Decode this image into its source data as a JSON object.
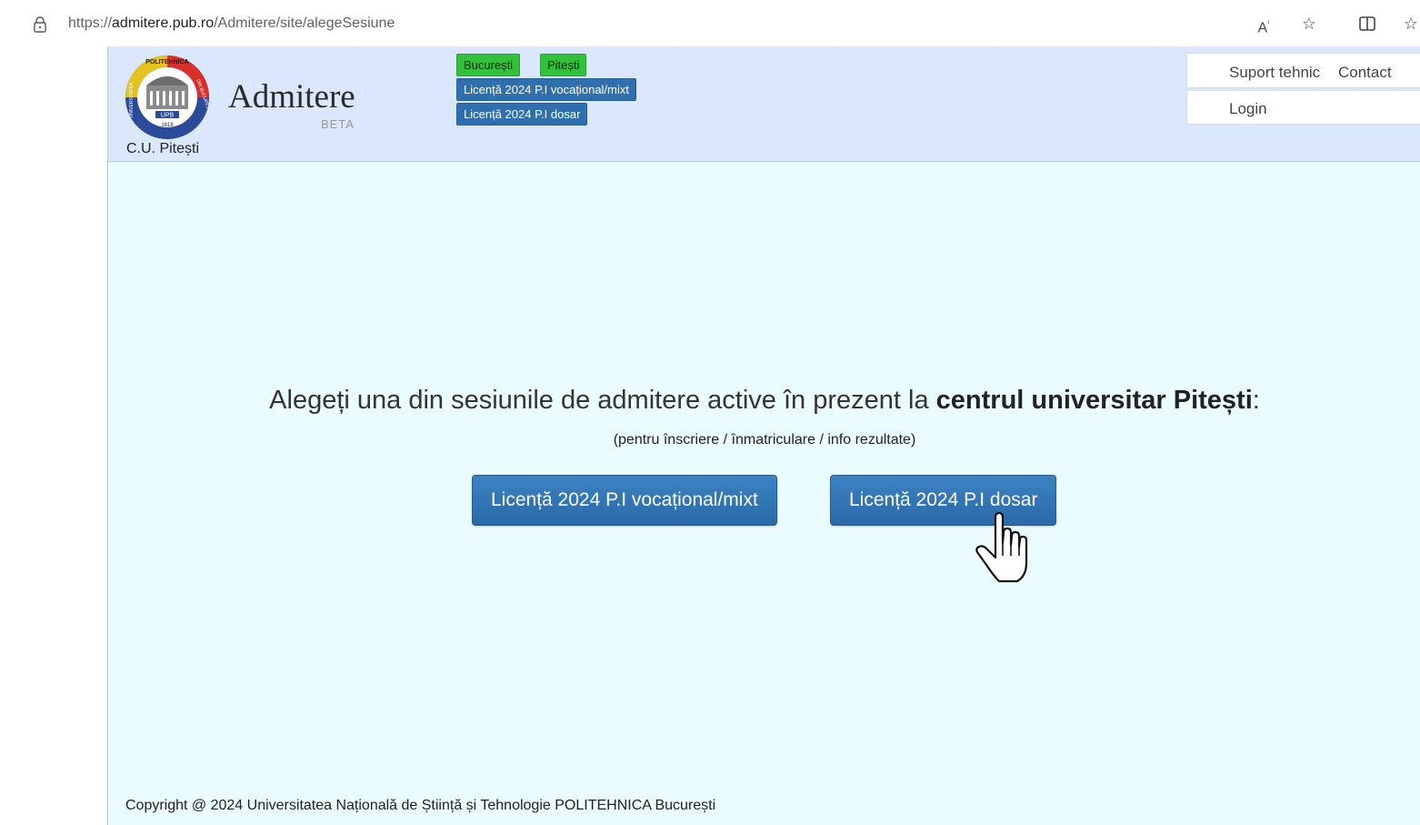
{
  "browser": {
    "url_prefix": "https://",
    "url_host": "admitere.pub.ro",
    "url_path": "/Admitere/site/alegeSesiune",
    "icons": [
      "lock-icon",
      "read-aloud-icon",
      "favorite-star-icon",
      "split-screen-icon",
      "favorites-icon"
    ]
  },
  "header": {
    "brand": "Admitere",
    "beta": "BETA",
    "center_label": "C.U. Pitești",
    "city_tags": [
      "București",
      "Pitești"
    ],
    "session_tags": [
      "Licență 2024 P.I vocațional/mixt",
      "Licență 2024 P.I dosar"
    ],
    "nav": {
      "support": "Suport tehnic",
      "contact": "Contact",
      "login": "Login"
    },
    "logo_text": {
      "top": "POLITEHNICA",
      "left": "UNIVERSITATEA",
      "right": "DIN BUCUREȘTI",
      "mid": "UPB",
      "year": "1818"
    }
  },
  "main": {
    "headline_pre": "Alegeți una din sesiunile de admitere active în prezent la ",
    "headline_bold": "centrul universitar Pitești",
    "headline_post": ":",
    "subline": "(pentru înscriere / înmatriculare / info rezultate)",
    "session_buttons": [
      "Licență 2024 P.I vocațional/mixt",
      "Licență 2024 P.I dosar"
    ]
  },
  "footer": {
    "copyright": "Copyright @ 2024 Universitatea Națională de Știință și Tehnologie POLITEHNICA București"
  },
  "colors": {
    "header_bg": "#dbe7fc",
    "page_bg": "#eafcfd",
    "tag_green": "#33c03a",
    "button_blue": "#2f6fae"
  }
}
